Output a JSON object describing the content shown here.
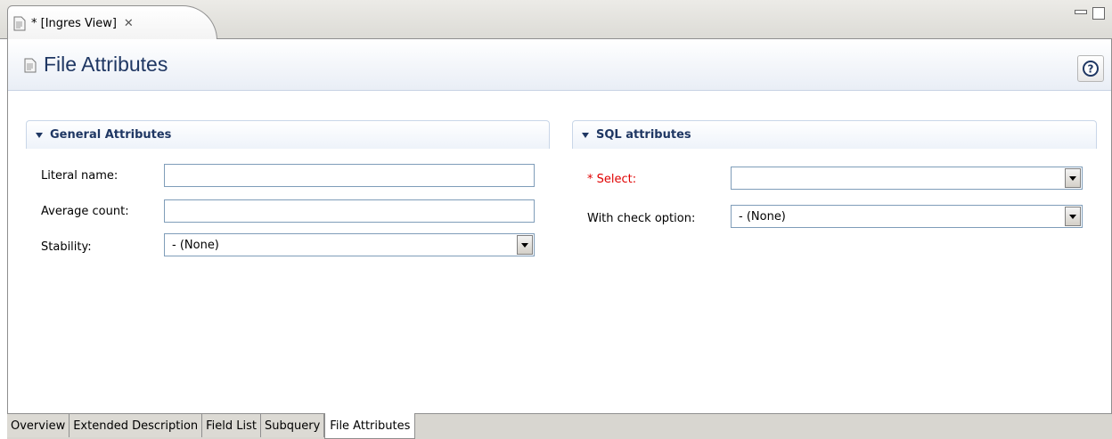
{
  "editor_tab": {
    "title": "* [Ingres View]",
    "close_icon": "close-icon"
  },
  "window_controls": {
    "minimize_icon": "minimize-icon",
    "maximize_icon": "maximize-icon"
  },
  "form": {
    "title": "File Attributes",
    "help_icon": "help-icon",
    "help_glyph": "?"
  },
  "general": {
    "title": "General Attributes",
    "literal_name_label": "Literal name:",
    "literal_name_value": "",
    "average_count_label": "Average count:",
    "average_count_value": "",
    "stability_label": "Stability:",
    "stability_value": "- (None)"
  },
  "sql": {
    "title": "SQL attributes",
    "select_label": "* Select:",
    "select_value": "",
    "check_option_label": "With check option:",
    "check_option_value": "- (None)"
  },
  "page_tabs": [
    "Overview",
    "Extended Description",
    "Field List",
    "Subquery",
    "File Attributes"
  ],
  "active_page_tab": "File Attributes",
  "colors": {
    "title": "#1f3763",
    "required": "#e00000",
    "field_border": "#7f9db9"
  }
}
